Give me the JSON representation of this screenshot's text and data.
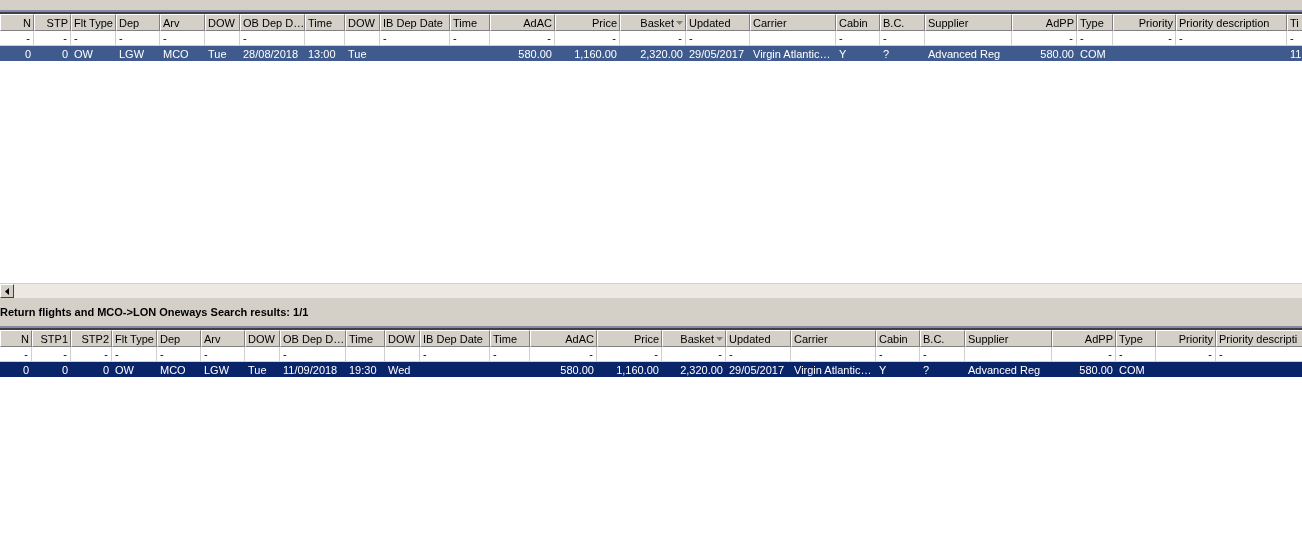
{
  "tables": [
    {
      "active": false,
      "scrollbar": true,
      "columns": [
        {
          "label": "N",
          "kind": "number"
        },
        {
          "label": "STP",
          "kind": "number"
        },
        {
          "label": "Flt Type",
          "kind": "text"
        },
        {
          "label": "Dep",
          "kind": "text"
        },
        {
          "label": "Arv",
          "kind": "text"
        },
        {
          "label": "DOW",
          "kind": "text"
        },
        {
          "label": "OB Dep D…",
          "kind": "text"
        },
        {
          "label": "Time",
          "kind": "text"
        },
        {
          "label": "DOW",
          "kind": "text"
        },
        {
          "label": "IB Dep Date",
          "kind": "text"
        },
        {
          "label": "Time",
          "kind": "text"
        },
        {
          "label": "AdAC",
          "kind": "number"
        },
        {
          "label": "Price",
          "kind": "number"
        },
        {
          "label": "Basket",
          "kind": "number",
          "sorted": true
        },
        {
          "label": "Updated",
          "kind": "text"
        },
        {
          "label": "Carrier",
          "kind": "text"
        },
        {
          "label": "Cabin",
          "kind": "text"
        },
        {
          "label": "B.C.",
          "kind": "text"
        },
        {
          "label": "Supplier",
          "kind": "text"
        },
        {
          "label": "AdPP",
          "kind": "number"
        },
        {
          "label": "Type",
          "kind": "text"
        },
        {
          "label": "Priority",
          "kind": "number"
        },
        {
          "label": "Priority description",
          "kind": "text"
        },
        {
          "label": "Ti",
          "kind": "text"
        }
      ],
      "filters": [
        {
          "kind": "dash",
          "text": "-"
        },
        {
          "kind": "dash",
          "text": "-"
        },
        {
          "kind": "dash",
          "text": "-"
        },
        {
          "kind": "dash",
          "text": "-"
        },
        {
          "kind": "dash",
          "text": "-"
        },
        {
          "kind": "empty"
        },
        {
          "kind": "dash",
          "text": "-"
        },
        {
          "kind": "empty"
        },
        {
          "kind": "empty"
        },
        {
          "kind": "dash",
          "text": "-"
        },
        {
          "kind": "dash",
          "text": "-"
        },
        {
          "kind": "dash",
          "text": "-"
        },
        {
          "kind": "dash",
          "text": "-"
        },
        {
          "kind": "dash",
          "text": "-"
        },
        {
          "kind": "dash",
          "text": "-"
        },
        {
          "kind": "empty"
        },
        {
          "kind": "dash",
          "text": "-"
        },
        {
          "kind": "dash",
          "text": "-"
        },
        {
          "kind": "empty"
        },
        {
          "kind": "dash",
          "text": "-"
        },
        {
          "kind": "dash",
          "text": "-"
        },
        {
          "kind": "dash",
          "text": "-"
        },
        {
          "kind": "dash",
          "text": "-"
        },
        {
          "kind": "dash",
          "text": "-"
        }
      ],
      "rows": [
        {
          "selected": true,
          "cells": [
            "0",
            "0",
            "OW",
            "LGW",
            "MCO",
            "Tue",
            "28/08/2018",
            "13:00",
            "Tue",
            null,
            null,
            "580.00",
            "1,160.00",
            "2,320.00",
            "29/05/2017",
            "Virgin Atlantic…",
            "Y",
            "?",
            "Advanced Reg",
            "580.00",
            "COM",
            null,
            null,
            "11"
          ]
        }
      ]
    },
    {
      "active": true,
      "scrollbar": false,
      "title": "Return flights and MCO->LON Oneways Search results: 1/1",
      "columns": [
        {
          "label": "N",
          "kind": "number"
        },
        {
          "label": "STP1",
          "kind": "number"
        },
        {
          "label": "STP2",
          "kind": "number"
        },
        {
          "label": "Flt Type",
          "kind": "text"
        },
        {
          "label": "Dep",
          "kind": "text"
        },
        {
          "label": "Arv",
          "kind": "text"
        },
        {
          "label": "DOW",
          "kind": "text"
        },
        {
          "label": "OB Dep D…",
          "kind": "text"
        },
        {
          "label": "Time",
          "kind": "text"
        },
        {
          "label": "DOW",
          "kind": "text"
        },
        {
          "label": "IB Dep Date",
          "kind": "text"
        },
        {
          "label": "Time",
          "kind": "text"
        },
        {
          "label": "AdAC",
          "kind": "number"
        },
        {
          "label": "Price",
          "kind": "number"
        },
        {
          "label": "Basket",
          "kind": "number",
          "sorted": true
        },
        {
          "label": "Updated",
          "kind": "text"
        },
        {
          "label": "Carrier",
          "kind": "text"
        },
        {
          "label": "Cabin",
          "kind": "text"
        },
        {
          "label": "B.C.",
          "kind": "text"
        },
        {
          "label": "Supplier",
          "kind": "text"
        },
        {
          "label": "AdPP",
          "kind": "number"
        },
        {
          "label": "Type",
          "kind": "text"
        },
        {
          "label": "Priority",
          "kind": "number"
        },
        {
          "label": "Priority descripti",
          "kind": "text"
        }
      ],
      "filters": [
        {
          "kind": "dash",
          "text": "-"
        },
        {
          "kind": "dash",
          "text": "-"
        },
        {
          "kind": "dash",
          "text": "-"
        },
        {
          "kind": "dash",
          "text": "-"
        },
        {
          "kind": "dash",
          "text": "-"
        },
        {
          "kind": "dash",
          "text": "-"
        },
        {
          "kind": "empty"
        },
        {
          "kind": "dash",
          "text": "-"
        },
        {
          "kind": "empty"
        },
        {
          "kind": "empty"
        },
        {
          "kind": "dash",
          "text": "-"
        },
        {
          "kind": "dash",
          "text": "-"
        },
        {
          "kind": "dash",
          "text": "-"
        },
        {
          "kind": "dash",
          "text": "-"
        },
        {
          "kind": "dash",
          "text": "-"
        },
        {
          "kind": "dash",
          "text": "-"
        },
        {
          "kind": "empty"
        },
        {
          "kind": "dash",
          "text": "-"
        },
        {
          "kind": "dash",
          "text": "-"
        },
        {
          "kind": "empty"
        },
        {
          "kind": "dash",
          "text": "-"
        },
        {
          "kind": "dash",
          "text": "-"
        },
        {
          "kind": "dash",
          "text": "-"
        },
        {
          "kind": "dash",
          "text": "-"
        }
      ],
      "rows": [
        {
          "selected": true,
          "cells": [
            "0",
            "0",
            "0",
            "OW",
            "MCO",
            "LGW",
            "Tue",
            "11/09/2018",
            "19:30",
            "Wed",
            null,
            null,
            "580.00",
            "1,160.00",
            "2,320.00",
            "29/05/2017",
            "Virgin Atlantic…",
            "Y",
            "?",
            "Advanced Reg",
            "580.00",
            "COM",
            null,
            null
          ]
        }
      ]
    }
  ]
}
